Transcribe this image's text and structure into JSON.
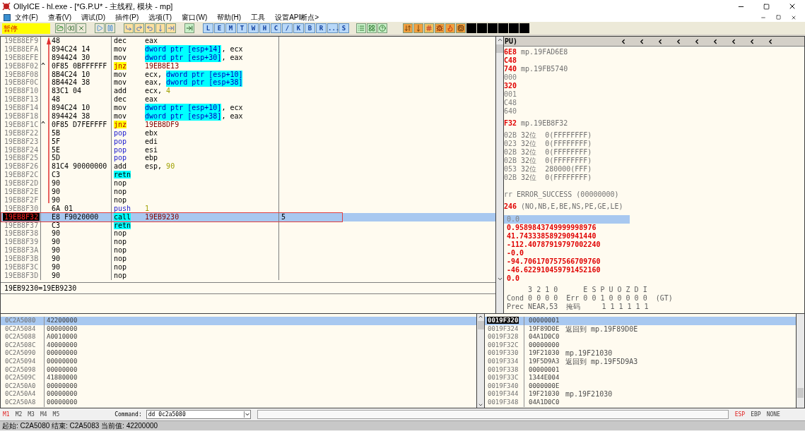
{
  "title_bar": {
    "title": "OllyICE - hl.exe - [*G.P.U* - 主线程, 模块 - mp]"
  },
  "menu": [
    "文件(F)",
    "查看(V)",
    "调试(D)",
    "插件(P)",
    "选项(T)",
    "窗口(W)",
    "帮助(H)",
    "工具",
    "设置API断点>"
  ],
  "toolbar": {
    "status": "暂停",
    "window_buttons": [
      "L",
      "E",
      "M",
      "T",
      "W",
      "H",
      "C",
      "/",
      "K",
      "B",
      "R",
      "...",
      "S"
    ]
  },
  "disassembly": {
    "rows": [
      {
        "address": "19EB8EF9",
        "hex": "48",
        "mnemonic": "dec",
        "kind": "plain",
        "operands": [
          {
            "text": "eax",
            "kind": "plain"
          }
        ],
        "selected": false
      },
      {
        "address": "19EB8EFA",
        "hex": "894C24 14",
        "mnemonic": "mov",
        "kind": "plain",
        "operands": [
          {
            "text": "dword ptr [esp+14]",
            "kind": "mem"
          },
          {
            "text": ", ecx",
            "kind": "plain"
          }
        ],
        "selected": false
      },
      {
        "address": "19EB8EFE",
        "hex": "894424 30",
        "mnemonic": "mov",
        "kind": "plain",
        "operands": [
          {
            "text": "dword ptr [esp+30]",
            "kind": "mem"
          },
          {
            "text": ", eax",
            "kind": "plain"
          }
        ],
        "selected": false
      },
      {
        "address": "19EB8F02",
        "mark": "^",
        "hex": "0F85 0BFFFFFF",
        "mnemonic": "jnz",
        "kind": "jump",
        "operands": [
          {
            "text": "19EB8E13",
            "kind": "addr"
          }
        ],
        "selected": false
      },
      {
        "address": "19EB8F08",
        "hex": "8B4C24 10",
        "mnemonic": "mov",
        "kind": "plain",
        "operands": [
          {
            "text": "ecx, ",
            "kind": "plain"
          },
          {
            "text": "dword ptr [esp+10]",
            "kind": "mem"
          }
        ],
        "selected": false
      },
      {
        "address": "19EB8F0C",
        "hex": "8B4424 38",
        "mnemonic": "mov",
        "kind": "plain",
        "operands": [
          {
            "text": "eax, ",
            "kind": "plain"
          },
          {
            "text": "dword ptr [esp+38]",
            "kind": "mem"
          }
        ],
        "selected": false
      },
      {
        "address": "19EB8F10",
        "hex": "83C1 04",
        "mnemonic": "add",
        "kind": "plain",
        "operands": [
          {
            "text": "ecx, ",
            "kind": "plain"
          },
          {
            "text": "4",
            "kind": "const"
          }
        ],
        "selected": false
      },
      {
        "address": "19EB8F13",
        "hex": "48",
        "mnemonic": "dec",
        "kind": "plain",
        "operands": [
          {
            "text": "eax",
            "kind": "plain"
          }
        ],
        "selected": false
      },
      {
        "address": "19EB8F14",
        "hex": "894C24 10",
        "mnemonic": "mov",
        "kind": "plain",
        "operands": [
          {
            "text": "dword ptr [esp+10]",
            "kind": "mem"
          },
          {
            "text": ", ecx",
            "kind": "plain"
          }
        ],
        "selected": false
      },
      {
        "address": "19EB8F18",
        "hex": "894424 38",
        "mnemonic": "mov",
        "kind": "plain",
        "operands": [
          {
            "text": "dword ptr [esp+38]",
            "kind": "mem"
          },
          {
            "text": ", eax",
            "kind": "plain"
          }
        ],
        "selected": false
      },
      {
        "address": "19EB8F1C",
        "mark": "^",
        "hex": "0F85 D7FEFFFF",
        "mnemonic": "jnz",
        "kind": "jump",
        "operands": [
          {
            "text": "19EB8DF9",
            "kind": "addr"
          }
        ],
        "selected": false
      },
      {
        "address": "19EB8F22",
        "hex": "5B",
        "mnemonic": "pop",
        "kind": "stack",
        "operands": [
          {
            "text": "ebx",
            "kind": "plain"
          }
        ],
        "selected": false
      },
      {
        "address": "19EB8F23",
        "hex": "5F",
        "mnemonic": "pop",
        "kind": "stack",
        "operands": [
          {
            "text": "edi",
            "kind": "plain"
          }
        ],
        "selected": false
      },
      {
        "address": "19EB8F24",
        "hex": "5E",
        "mnemonic": "pop",
        "kind": "stack",
        "operands": [
          {
            "text": "esi",
            "kind": "plain"
          }
        ],
        "selected": false
      },
      {
        "address": "19EB8F25",
        "hex": "5D",
        "mnemonic": "pop",
        "kind": "stack",
        "operands": [
          {
            "text": "ebp",
            "kind": "plain"
          }
        ],
        "selected": false
      },
      {
        "address": "19EB8F26",
        "hex": "81C4 90000000",
        "mnemonic": "add",
        "kind": "plain",
        "operands": [
          {
            "text": "esp, ",
            "kind": "plain"
          },
          {
            "text": "90",
            "kind": "const"
          }
        ],
        "selected": false
      },
      {
        "address": "19EB8F2C",
        "hex": "C3",
        "mnemonic": "retn",
        "kind": "ret",
        "operands": [],
        "selected": false
      },
      {
        "address": "19EB8F2D",
        "hex": "90",
        "mnemonic": "nop",
        "kind": "plain",
        "operands": [],
        "selected": false
      },
      {
        "address": "19EB8F2E",
        "hex": "90",
        "mnemonic": "nop",
        "kind": "plain",
        "operands": [],
        "selected": false
      },
      {
        "address": "19EB8F2F",
        "hex": "90",
        "mnemonic": "nop",
        "kind": "plain",
        "operands": [],
        "selected": false
      },
      {
        "address": "19EB8F30",
        "hex": "6A 01",
        "mnemonic": "push",
        "kind": "stack",
        "operands": [
          {
            "text": "1",
            "kind": "const"
          }
        ],
        "selected": false
      },
      {
        "address": "19EB8F32",
        "hex": "E8 F9020000",
        "mnemonic": "call",
        "kind": "call",
        "operands": [
          {
            "text": "19EB9230",
            "kind": "addr"
          }
        ],
        "comment": "5",
        "selected": true
      },
      {
        "address": "19EB8F37",
        "hex": "C3",
        "mnemonic": "retn",
        "kind": "ret",
        "operands": [],
        "selected": false
      },
      {
        "address": "19EB8F38",
        "hex": "90",
        "mnemonic": "nop",
        "kind": "plain",
        "operands": [],
        "selected": false
      },
      {
        "address": "19EB8F39",
        "hex": "90",
        "mnemonic": "nop",
        "kind": "plain",
        "operands": [],
        "selected": false
      },
      {
        "address": "19EB8F3A",
        "hex": "90",
        "mnemonic": "nop",
        "kind": "plain",
        "operands": [],
        "selected": false
      },
      {
        "address": "19EB8F3B",
        "hex": "90",
        "mnemonic": "nop",
        "kind": "plain",
        "operands": [],
        "selected": false
      },
      {
        "address": "19EB8F3C",
        "hex": "90",
        "mnemonic": "nop",
        "kind": "plain",
        "operands": [],
        "selected": false
      },
      {
        "address": "19EB8F3D",
        "hex": "90",
        "mnemonic": "nop",
        "kind": "plain",
        "operands": [],
        "selected": false
      }
    ],
    "info": "19EB9230=19EB9230"
  },
  "registers": {
    "title": "PU)",
    "groups": [
      [
        {
          "value": "6E8",
          "changed": true,
          "text": "mp.19FAD6E8"
        },
        {
          "value": "C48",
          "changed": true
        },
        {
          "value": "740",
          "changed": true,
          "text": "mp.19FB5740"
        },
        {
          "value": "000",
          "changed": false
        },
        {
          "value": "320",
          "changed": true
        },
        {
          "value": "001",
          "changed": false
        },
        {
          "value": "C48",
          "changed": false
        },
        {
          "value": "640",
          "changed": false
        }
      ],
      [
        {
          "value": "F32",
          "changed": true,
          "text": "mp.19EB8F32"
        }
      ],
      [
        {
          "value": "02B",
          "changed": false,
          "text": "32位  0(FFFFFFFF)"
        },
        {
          "value": "023",
          "changed": false,
          "text": "32位  0(FFFFFFFF)"
        },
        {
          "value": "02B",
          "changed": false,
          "text": "32位  0(FFFFFFFF)"
        },
        {
          "value": "02B",
          "changed": false,
          "text": "32位  0(FFFFFFFF)"
        },
        {
          "value": "053",
          "changed": false,
          "text": "32位  280000(FFF)"
        },
        {
          "value": "02B",
          "changed": false,
          "text": "32位  0(FFFFFFFF)"
        }
      ],
      [
        {
          "value": "rr",
          "changed": false,
          "text": "ERROR_SUCCESS (00000000)"
        }
      ],
      [
        {
          "value": "246",
          "changed": true,
          "text": "(NO,NB,E,BE,NS,PE,GE,LE)"
        }
      ]
    ],
    "fpu": [
      {
        "value": "0.0",
        "changed": false,
        "selected": true
      },
      {
        "value": "0.9589843749999998976",
        "changed": true,
        "selected": false
      },
      {
        "value": "41.743338589290941440",
        "changed": true,
        "selected": false
      },
      {
        "value": "-112.40787919797002240",
        "changed": true,
        "selected": false
      },
      {
        "value": "-0.0",
        "changed": true,
        "selected": false
      },
      {
        "value": "-94.706170757566709760",
        "changed": true,
        "selected": false
      },
      {
        "value": "-46.622910459791452160",
        "changed": true,
        "selected": false
      },
      {
        "value": "0.0",
        "changed": true,
        "selected": false
      }
    ],
    "fpu_status": [
      "     3 2 1 0      E S P U O Z D I",
      "Cond 0 0 0 0  Err 0 0 1 0 0 0 0 0  (GT)",
      "Prec NEAR,53  掩码     1 1 1 1 1 1"
    ]
  },
  "dump": {
    "rows": [
      {
        "address": "0C2A5080",
        "value": "42200000",
        "selected": true
      },
      {
        "address": "0C2A5084",
        "value": "00000000",
        "selected": false
      },
      {
        "address": "0C2A5088",
        "value": "A0010000",
        "selected": false
      },
      {
        "address": "0C2A508C",
        "value": "40000000",
        "selected": false
      },
      {
        "address": "0C2A5090",
        "value": "00000000",
        "selected": false
      },
      {
        "address": "0C2A5094",
        "value": "00000000",
        "selected": false
      },
      {
        "address": "0C2A5098",
        "value": "00000000",
        "selected": false
      },
      {
        "address": "0C2A509C",
        "value": "41880000",
        "selected": false
      },
      {
        "address": "0C2A50A0",
        "value": "00000000",
        "selected": false
      },
      {
        "address": "0C2A50A4",
        "value": "00000000",
        "selected": false
      },
      {
        "address": "0C2A50A8",
        "value": "00000000",
        "selected": false
      }
    ]
  },
  "stack": {
    "rows": [
      {
        "address": "0019F320",
        "value": "00000001",
        "selected": true
      },
      {
        "address": "0019F324",
        "value": "19F89D0E",
        "comment": "返回到 mp.19F89D0E",
        "selected": false
      },
      {
        "address": "0019F328",
        "value": "04A1D0C0",
        "selected": false
      },
      {
        "address": "0019F32C",
        "value": "00000000",
        "selected": false
      },
      {
        "address": "0019F330",
        "value": "19F21030",
        "comment": "mp.19F21030",
        "selected": false
      },
      {
        "address": "0019F334",
        "value": "19F5D9A3",
        "comment": "返回到 mp.19F5D9A3",
        "selected": false
      },
      {
        "address": "0019F338",
        "value": "00000001",
        "selected": false
      },
      {
        "address": "0019F33C",
        "value": "1344E004",
        "selected": false
      },
      {
        "address": "0019F340",
        "value": "0000000E",
        "selected": false
      },
      {
        "address": "0019F344",
        "value": "19F21030",
        "comment": "mp.19F21030",
        "selected": false
      },
      {
        "address": "0019F348",
        "value": "04A1D0C0",
        "selected": false
      }
    ]
  },
  "command_bar": {
    "memory_tabs": [
      {
        "label": "M1",
        "selected": true
      },
      {
        "label": "M2",
        "selected": false
      },
      {
        "label": "M3",
        "selected": false
      },
      {
        "label": "M4",
        "selected": false
      },
      {
        "label": "M5",
        "selected": false
      }
    ],
    "label": "Command:",
    "value": "dd 0c2a5080",
    "stack_modes": [
      {
        "label": "ESP",
        "selected": true
      },
      {
        "label": "EBP",
        "selected": false
      },
      {
        "label": "NONE",
        "selected": false
      }
    ]
  },
  "status_bar": {
    "text": "起始: C2A5080 结束: C2A5083 当前值: 42200000"
  }
}
